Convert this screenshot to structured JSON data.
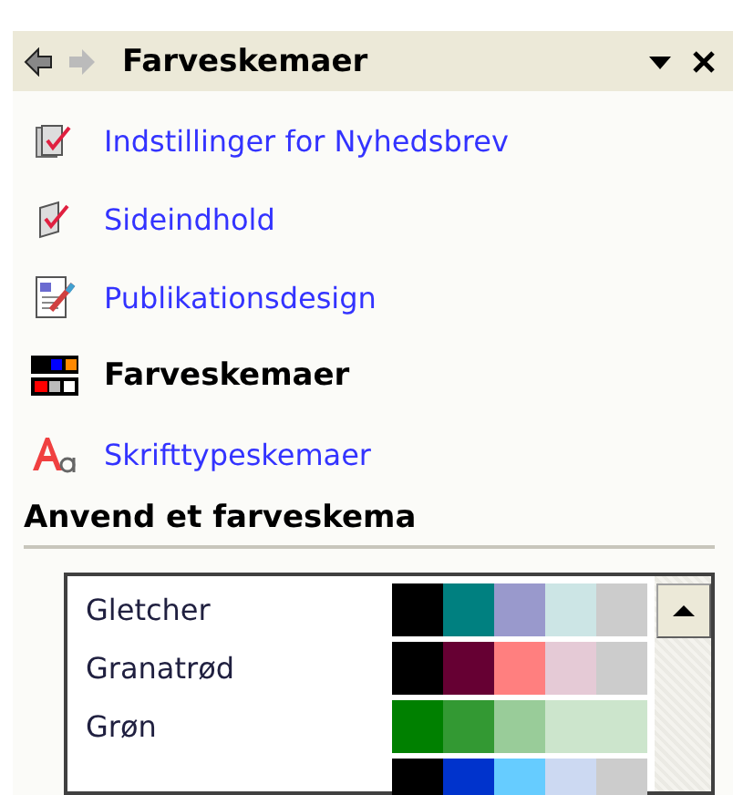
{
  "header": {
    "title": "Farveskemaer"
  },
  "tasks": [
    {
      "label": "Indstillinger for Nyhedsbrev",
      "kind": "settings",
      "selected": false
    },
    {
      "label": "Sideindhold",
      "kind": "content",
      "selected": false
    },
    {
      "label": "Publikationsdesign",
      "kind": "design",
      "selected": false
    },
    {
      "label": "Farveskemaer",
      "kind": "colors",
      "selected": true
    },
    {
      "label": "Skrifttypeskemaer",
      "kind": "fonts",
      "selected": false
    }
  ],
  "section": {
    "title": "Anvend et farveskema"
  },
  "schemes": [
    {
      "name": "Gletcher",
      "swatches": [
        {
          "color": "#000000"
        },
        {
          "color": "#008080"
        },
        {
          "color": "#9999cc"
        },
        {
          "color": "#cce5e5"
        },
        {
          "color": "#cccccc"
        }
      ]
    },
    {
      "name": "Granatrød",
      "swatches": [
        {
          "color": "#000000"
        },
        {
          "color": "#660033"
        },
        {
          "color": "#ff7f7f"
        },
        {
          "color": "#e5cad6"
        },
        {
          "color": "#cccccc"
        }
      ]
    },
    {
      "name": "Grøn",
      "swatches": [
        {
          "color": "#008000"
        },
        {
          "color": "#339933"
        },
        {
          "color": "#99cc99"
        },
        {
          "color": "#cce5cc"
        },
        {
          "color": "#cce5cc"
        }
      ]
    },
    {
      "swatches": [
        {
          "color": "#000000"
        },
        {
          "color": "#0033cc"
        },
        {
          "color": "#66ccff"
        },
        {
          "color": "#ccd9f2"
        },
        {
          "color": "#cccccc"
        }
      ]
    }
  ]
}
